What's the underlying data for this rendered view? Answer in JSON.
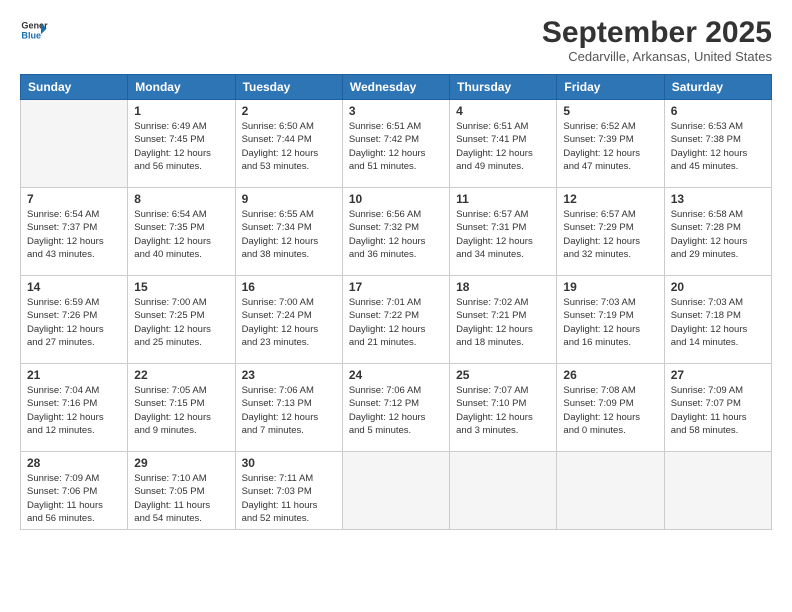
{
  "logo": {
    "line1": "General",
    "line2": "Blue"
  },
  "title": "September 2025",
  "location": "Cedarville, Arkansas, United States",
  "weekdays": [
    "Sunday",
    "Monday",
    "Tuesday",
    "Wednesday",
    "Thursday",
    "Friday",
    "Saturday"
  ],
  "weeks": [
    [
      {
        "day": "",
        "empty": true
      },
      {
        "day": "1",
        "sunrise": "6:49 AM",
        "sunset": "7:45 PM",
        "daylight": "12 hours and 56 minutes."
      },
      {
        "day": "2",
        "sunrise": "6:50 AM",
        "sunset": "7:44 PM",
        "daylight": "12 hours and 53 minutes."
      },
      {
        "day": "3",
        "sunrise": "6:51 AM",
        "sunset": "7:42 PM",
        "daylight": "12 hours and 51 minutes."
      },
      {
        "day": "4",
        "sunrise": "6:51 AM",
        "sunset": "7:41 PM",
        "daylight": "12 hours and 49 minutes."
      },
      {
        "day": "5",
        "sunrise": "6:52 AM",
        "sunset": "7:39 PM",
        "daylight": "12 hours and 47 minutes."
      },
      {
        "day": "6",
        "sunrise": "6:53 AM",
        "sunset": "7:38 PM",
        "daylight": "12 hours and 45 minutes."
      }
    ],
    [
      {
        "day": "7",
        "sunrise": "6:54 AM",
        "sunset": "7:37 PM",
        "daylight": "12 hours and 43 minutes."
      },
      {
        "day": "8",
        "sunrise": "6:54 AM",
        "sunset": "7:35 PM",
        "daylight": "12 hours and 40 minutes."
      },
      {
        "day": "9",
        "sunrise": "6:55 AM",
        "sunset": "7:34 PM",
        "daylight": "12 hours and 38 minutes."
      },
      {
        "day": "10",
        "sunrise": "6:56 AM",
        "sunset": "7:32 PM",
        "daylight": "12 hours and 36 minutes."
      },
      {
        "day": "11",
        "sunrise": "6:57 AM",
        "sunset": "7:31 PM",
        "daylight": "12 hours and 34 minutes."
      },
      {
        "day": "12",
        "sunrise": "6:57 AM",
        "sunset": "7:29 PM",
        "daylight": "12 hours and 32 minutes."
      },
      {
        "day": "13",
        "sunrise": "6:58 AM",
        "sunset": "7:28 PM",
        "daylight": "12 hours and 29 minutes."
      }
    ],
    [
      {
        "day": "14",
        "sunrise": "6:59 AM",
        "sunset": "7:26 PM",
        "daylight": "12 hours and 27 minutes."
      },
      {
        "day": "15",
        "sunrise": "7:00 AM",
        "sunset": "7:25 PM",
        "daylight": "12 hours and 25 minutes."
      },
      {
        "day": "16",
        "sunrise": "7:00 AM",
        "sunset": "7:24 PM",
        "daylight": "12 hours and 23 minutes."
      },
      {
        "day": "17",
        "sunrise": "7:01 AM",
        "sunset": "7:22 PM",
        "daylight": "12 hours and 21 minutes."
      },
      {
        "day": "18",
        "sunrise": "7:02 AM",
        "sunset": "7:21 PM",
        "daylight": "12 hours and 18 minutes."
      },
      {
        "day": "19",
        "sunrise": "7:03 AM",
        "sunset": "7:19 PM",
        "daylight": "12 hours and 16 minutes."
      },
      {
        "day": "20",
        "sunrise": "7:03 AM",
        "sunset": "7:18 PM",
        "daylight": "12 hours and 14 minutes."
      }
    ],
    [
      {
        "day": "21",
        "sunrise": "7:04 AM",
        "sunset": "7:16 PM",
        "daylight": "12 hours and 12 minutes."
      },
      {
        "day": "22",
        "sunrise": "7:05 AM",
        "sunset": "7:15 PM",
        "daylight": "12 hours and 9 minutes."
      },
      {
        "day": "23",
        "sunrise": "7:06 AM",
        "sunset": "7:13 PM",
        "daylight": "12 hours and 7 minutes."
      },
      {
        "day": "24",
        "sunrise": "7:06 AM",
        "sunset": "7:12 PM",
        "daylight": "12 hours and 5 minutes."
      },
      {
        "day": "25",
        "sunrise": "7:07 AM",
        "sunset": "7:10 PM",
        "daylight": "12 hours and 3 minutes."
      },
      {
        "day": "26",
        "sunrise": "7:08 AM",
        "sunset": "7:09 PM",
        "daylight": "12 hours and 0 minutes."
      },
      {
        "day": "27",
        "sunrise": "7:09 AM",
        "sunset": "7:07 PM",
        "daylight": "11 hours and 58 minutes."
      }
    ],
    [
      {
        "day": "28",
        "sunrise": "7:09 AM",
        "sunset": "7:06 PM",
        "daylight": "11 hours and 56 minutes."
      },
      {
        "day": "29",
        "sunrise": "7:10 AM",
        "sunset": "7:05 PM",
        "daylight": "11 hours and 54 minutes."
      },
      {
        "day": "30",
        "sunrise": "7:11 AM",
        "sunset": "7:03 PM",
        "daylight": "11 hours and 52 minutes."
      },
      {
        "day": "",
        "empty": true
      },
      {
        "day": "",
        "empty": true
      },
      {
        "day": "",
        "empty": true
      },
      {
        "day": "",
        "empty": true
      }
    ]
  ]
}
